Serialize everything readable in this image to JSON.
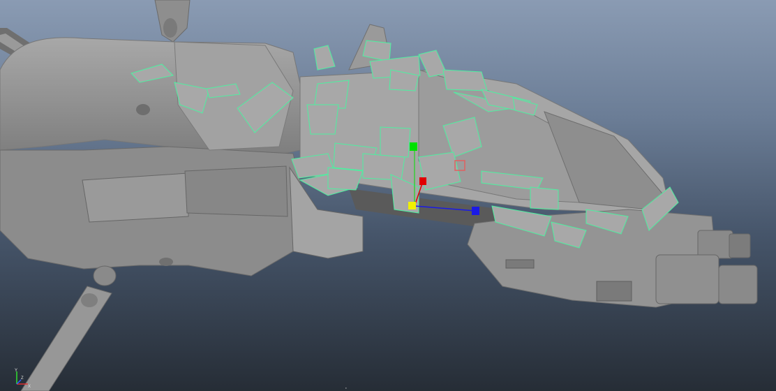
{
  "viewport": {
    "camera_label": "",
    "bottom_label": "·"
  },
  "axis_indicator": {
    "x_label": "X",
    "y_label": "Y",
    "z_label": "Z"
  },
  "colors": {
    "model_fill": "#9c9c9c",
    "model_shade": "#7e7e7e",
    "model_dark": "#5e5e5e",
    "wireframe_selected": "#4df0a0",
    "gizmo_x": "#1a1ae6",
    "gizmo_y": "#00e000",
    "gizmo_z": "#e00000",
    "gizmo_center": "#f0f000"
  }
}
